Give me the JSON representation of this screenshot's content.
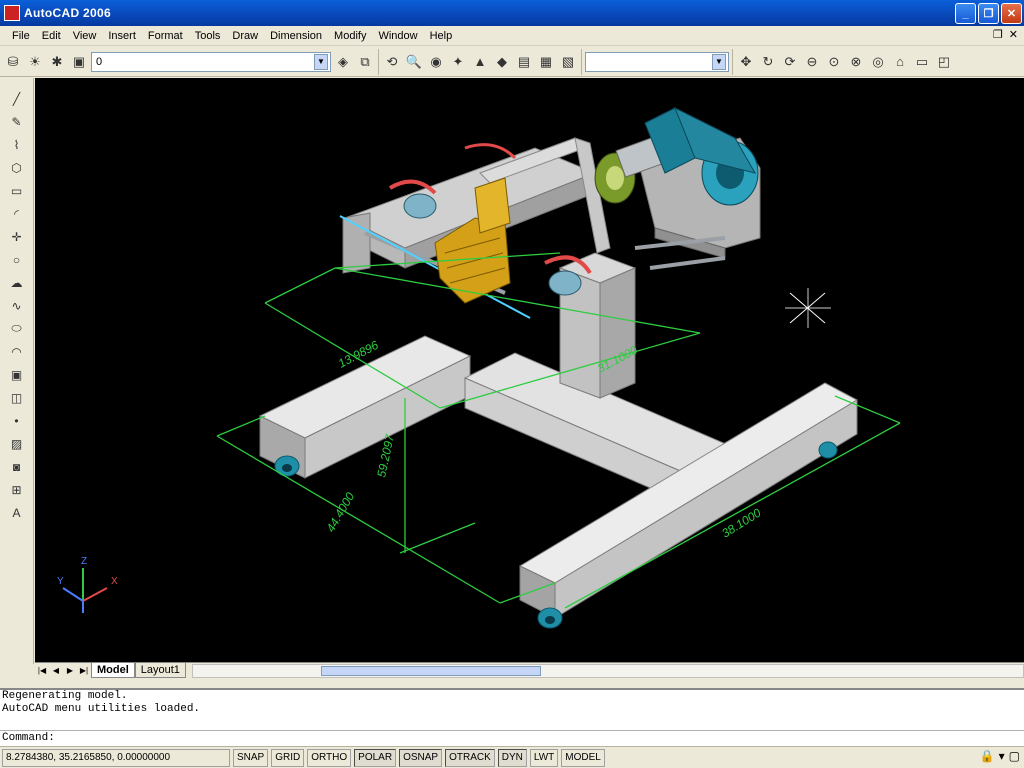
{
  "window": {
    "title": "AutoCAD 2006"
  },
  "menu": [
    "File",
    "Edit",
    "View",
    "Insert",
    "Format",
    "Tools",
    "Draw",
    "Dimension",
    "Modify",
    "Window",
    "Help"
  ],
  "layer_combo": {
    "value": "0"
  },
  "style_combo": {
    "value": ""
  },
  "drawing": {
    "dimensions": [
      "13.9896",
      "59.2097",
      "31.1000",
      "44.4000",
      "38.1000"
    ],
    "ucs": {
      "x": "X",
      "y": "Y",
      "z": "Z"
    }
  },
  "tabs": {
    "model": "Model",
    "layout1": "Layout1"
  },
  "command": {
    "history": [
      "Regenerating model.",
      "AutoCAD menu utilities loaded."
    ],
    "prompt": "Command:"
  },
  "status": {
    "coords": "8.2784380, 35.2165850, 0.00000000",
    "buttons": [
      "SNAP",
      "GRID",
      "ORTHO",
      "POLAR",
      "OSNAP",
      "OTRACK",
      "DYN",
      "LWT",
      "MODEL"
    ]
  },
  "colors": {
    "dimension": "#2ecc40",
    "frame": "#d4d4d4",
    "motor": "#1f8fa8",
    "clamp": "#d4a017",
    "background": "#000000"
  }
}
